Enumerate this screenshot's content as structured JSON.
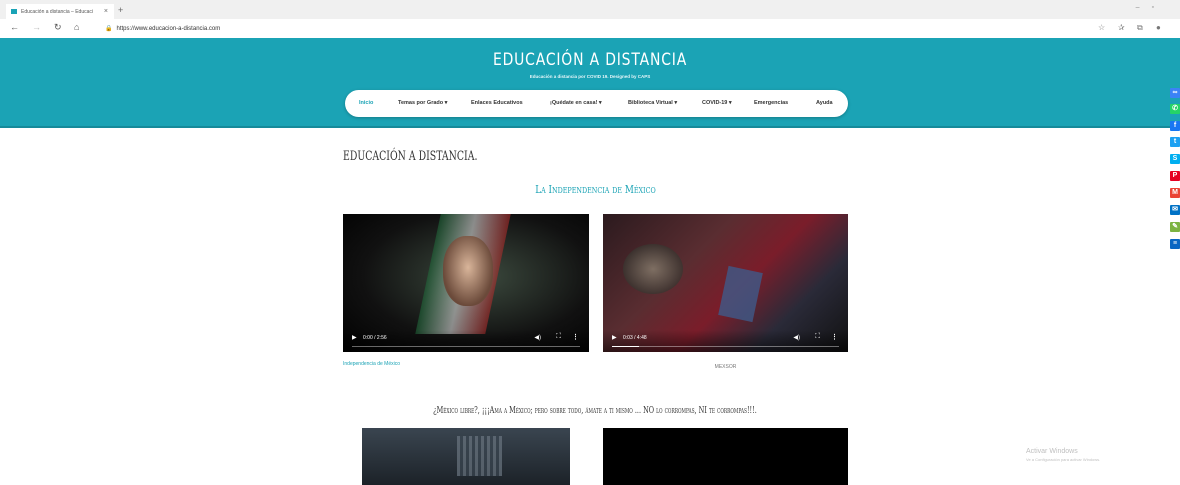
{
  "browser": {
    "tab_title": "Educación a distancia – Educaci",
    "tab_close": "×",
    "new_tab": "+",
    "url": "https://www.educacion-a-distancia.com"
  },
  "site": {
    "title": "EDUCACIÓN A DISTANCIA",
    "subtitle": "Educación a distancia por COVID 19. Designed by CAPS",
    "nav": [
      {
        "label": "Inicio"
      },
      {
        "label": "Temas por Grado ▾"
      },
      {
        "label": "Enlaces Educativos"
      },
      {
        "label": "¡Quédate en casa! ▾"
      },
      {
        "label": "Biblioteca Virtual ▾"
      },
      {
        "label": "COVID-19 ▾"
      },
      {
        "label": "Emergencias"
      },
      {
        "label": "Ayuda"
      }
    ]
  },
  "content": {
    "page_title": "EDUCACIÓN A DISTANCIA.",
    "section_title": "La Independencia de México",
    "videos": [
      {
        "time": "0:00 / 2:56",
        "progress": 0.0,
        "caption": "Independencia de México"
      },
      {
        "time": "0:03 / 4:48",
        "progress": 0.12,
        "caption": "MEXSOR"
      }
    ],
    "quote": "¿México libre?, ¡¡¡Ama a México; pero sobre todo, ámate a ti mismo ... NO lo corrompas, NI te corrompas!!!."
  },
  "windows_notice": {
    "title": "Activar Windows",
    "detail": "Ve a Configuración para activar Windows."
  },
  "share_colors": [
    "#3b82f6",
    "#25d366",
    "#1877f2",
    "#1da1f2",
    "#00aff0",
    "#e60023",
    "#ea4335",
    "#0072c6",
    "#7cb342",
    "#0a66c2"
  ]
}
